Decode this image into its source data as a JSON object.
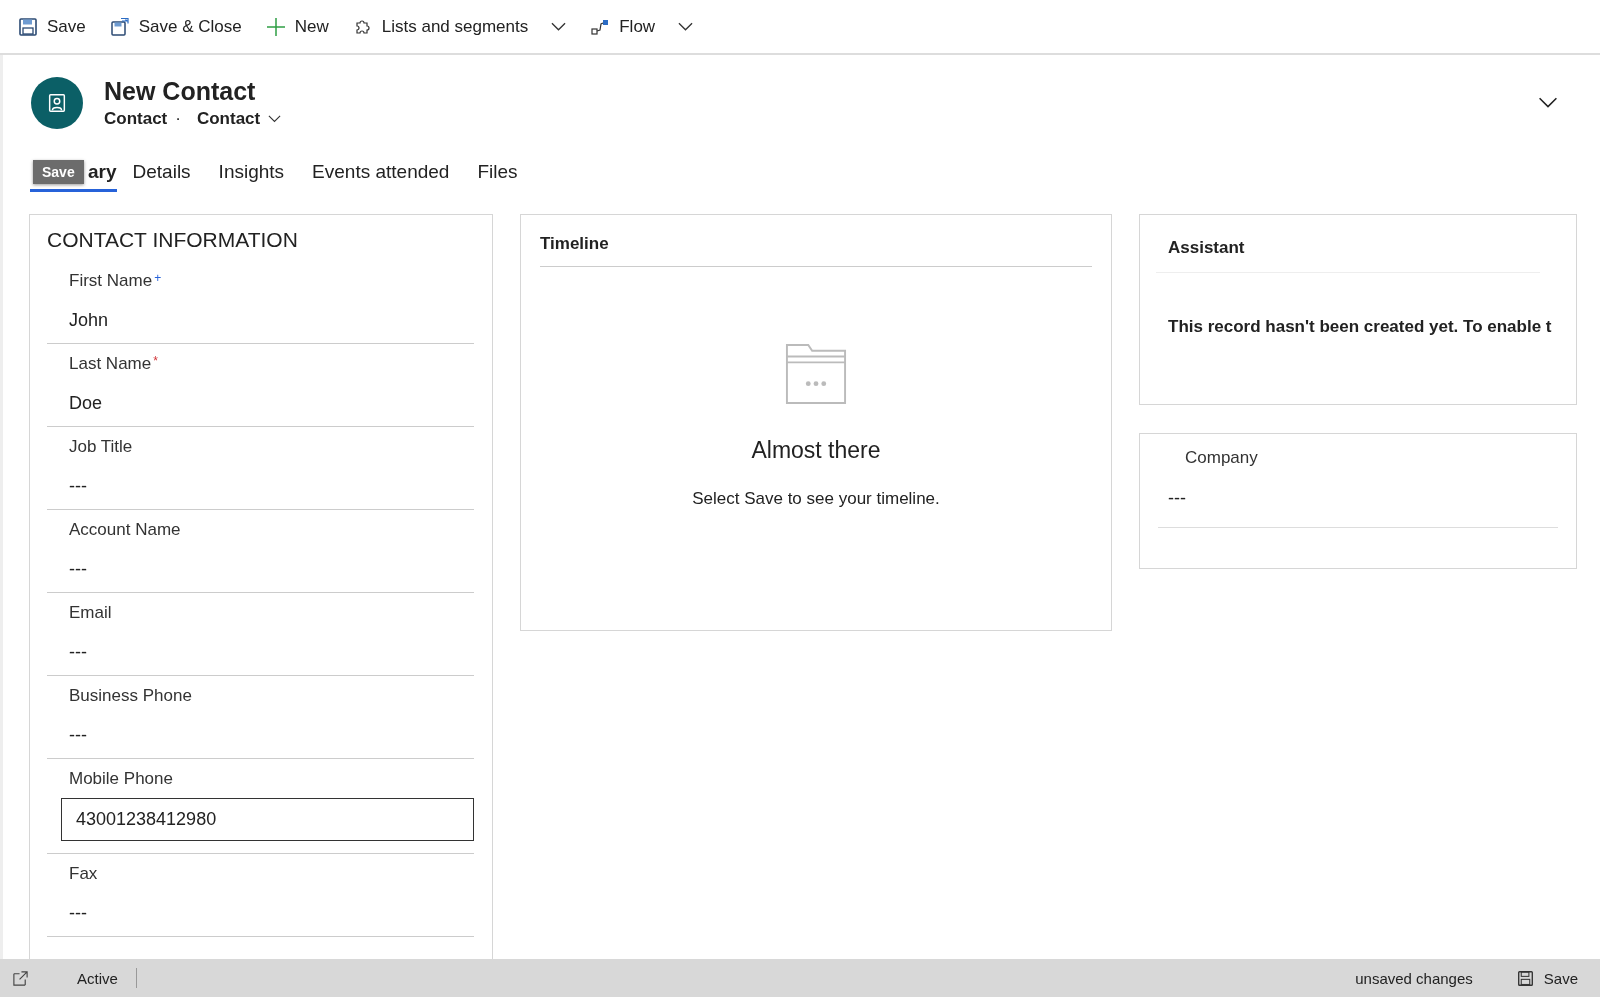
{
  "toolbar": [
    {
      "label": "Save",
      "dropdown": false
    },
    {
      "label": "Save & Close",
      "dropdown": false
    },
    {
      "label": "New",
      "dropdown": false
    },
    {
      "label": "Lists and segments",
      "dropdown": true
    },
    {
      "label": "Flow",
      "dropdown": true
    }
  ],
  "header": {
    "title": "New Contact",
    "entity": "Contact",
    "separator": "·",
    "form": "Contact"
  },
  "tabs": [
    {
      "label": "ary",
      "selected": true
    },
    {
      "label": "Details",
      "selected": false
    },
    {
      "label": "Insights",
      "selected": false
    },
    {
      "label": "Events attended",
      "selected": false
    },
    {
      "label": "Files",
      "selected": false
    }
  ],
  "tooltip": "Save",
  "contact_section": {
    "title": "CONTACT INFORMATION",
    "fields": [
      {
        "label": "First Name",
        "marker": "+",
        "required": false,
        "value": "John",
        "kind": "text"
      },
      {
        "label": "Last Name",
        "marker": "*",
        "required": true,
        "value": "Doe",
        "kind": "text"
      },
      {
        "label": "Job Title",
        "value": "---",
        "kind": "text"
      },
      {
        "label": "Account Name",
        "value": "---",
        "kind": "text"
      },
      {
        "label": "Email",
        "value": "---",
        "kind": "text"
      },
      {
        "label": "Business Phone",
        "value": "---",
        "kind": "text"
      },
      {
        "label": "Mobile Phone",
        "value": "43001238412980",
        "kind": "input"
      },
      {
        "label": "Fax",
        "value": "---",
        "kind": "text"
      }
    ]
  },
  "timeline": {
    "title": "Timeline",
    "heading": "Almost there",
    "message": "Select Save to see your timeline."
  },
  "assistant": {
    "title": "Assistant",
    "message": "This record hasn't been created yet. To enable t"
  },
  "company": {
    "label": "Company",
    "value": "---"
  },
  "status_bar": {
    "status": "Active",
    "changes": "unsaved changes",
    "save": "Save"
  }
}
